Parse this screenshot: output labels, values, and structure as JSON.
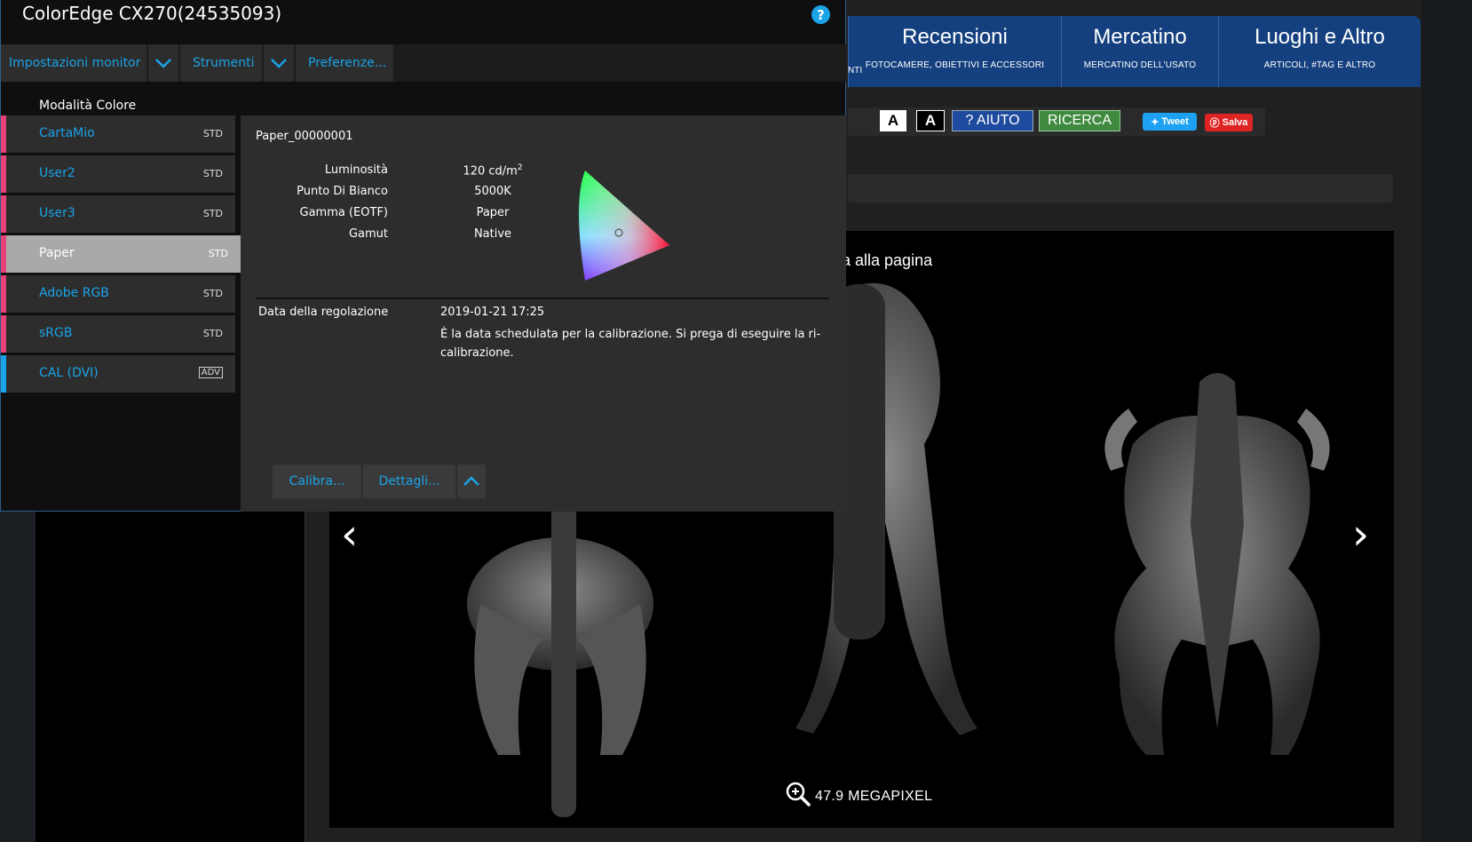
{
  "window": {
    "title": "ColorEdge CX270(24535093)",
    "help_glyph": "?",
    "accent": "#1aa3e8"
  },
  "menu": {
    "monitor_settings": "Impostazioni monitor",
    "tools": "Strumenti",
    "preferences": "Preferenze..."
  },
  "color_modes": {
    "heading": "Modalità Colore",
    "items": [
      {
        "label": "CartaMio",
        "tag": "STD",
        "bar_color": "#e8417a"
      },
      {
        "label": "User2",
        "tag": "STD",
        "bar_color": "#e8417a"
      },
      {
        "label": "User3",
        "tag": "STD",
        "bar_color": "#e8417a"
      },
      {
        "label": "Paper",
        "tag": "STD",
        "bar_color": "#e8417a",
        "selected": true
      },
      {
        "label": "Adobe RGB",
        "tag": "STD",
        "bar_color": "#e8417a"
      },
      {
        "label": "sRGB",
        "tag": "STD",
        "bar_color": "#e8417a"
      },
      {
        "label": "CAL (DVI)",
        "tag": "ADV",
        "bar_color": "#1aa3e8"
      }
    ]
  },
  "detail": {
    "profile_name": "Paper_00000001",
    "properties": [
      {
        "label": "Luminosità",
        "value": "120 cd/m",
        "sup": "2"
      },
      {
        "label": "Punto Di Bianco",
        "value": "5000K"
      },
      {
        "label": "Gamma (EOTF)",
        "value": "Paper"
      },
      {
        "label": "Gamut",
        "value": "Native"
      }
    ],
    "adjustment_label": "Data della regolazione",
    "adjustment_date": "2019-01-21 17:25",
    "adjustment_note": "È la data schedulata per la calibrazione. Si prega di eseguire la ri-calibrazione.",
    "calibrate_button": "Calibra...",
    "details_button": "Dettagli..."
  },
  "website": {
    "nav_stub": "NTI",
    "nav": [
      {
        "title": "Recensioni",
        "subtitle": "FOTOCAMERE, OBIETTIVI E ACCESSORI"
      },
      {
        "title": "Mercatino",
        "subtitle": "MERCATINO DELL'USATO"
      },
      {
        "title": "Luoghi e Altro",
        "subtitle": "ARTICOLI, #TAG E ALTRO"
      }
    ],
    "buttons": {
      "font_a1": "A",
      "font_a2": "A",
      "aiuto": "? AIUTO",
      "ricerca": "RICERCA",
      "tweet": "Tweet",
      "salva": "Salva"
    },
    "gallery_title": "a alla pagina",
    "arrow_left": "‹",
    "arrow_right": "›",
    "megapixel": "47.9 MEGAPIXEL",
    "nav_color": "#15407f"
  }
}
